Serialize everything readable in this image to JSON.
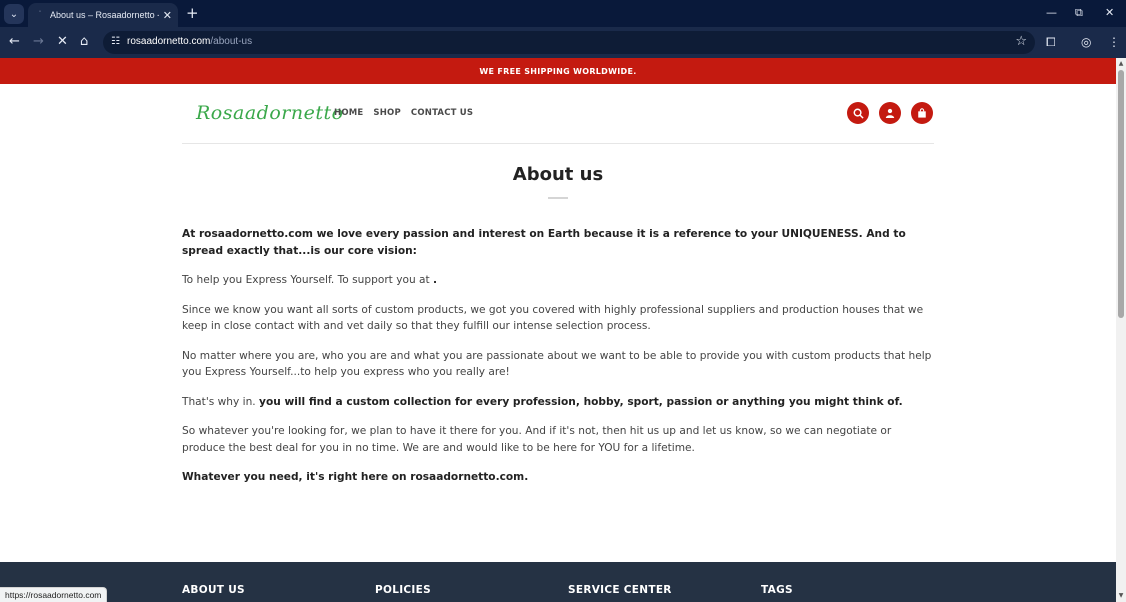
{
  "browser": {
    "tab_title": "About us – Rosaadornetto - Fre",
    "url_domain": "rosaadornetto.com",
    "url_path": "/about-us",
    "status_url": "https://rosaadornetto.com"
  },
  "site": {
    "announcement": "WE FREE SHIPPING WORLDWIDE.",
    "logo": "Rosaadornetto",
    "nav": [
      "HOME",
      "SHOP",
      "CONTACT US"
    ],
    "accent_color": "#c41a10",
    "logo_color": "#3aa84a"
  },
  "page": {
    "title": "About us",
    "p1": "At  rosaadornetto.com we love every passion and interest on Earth because it is a reference to your UNIQUENESS. And to spread exactly that...is our core vision:",
    "p2": "To help you Express Yourself. To support you at ",
    "p2_bold": ".",
    "p3": "Since we know you want all sorts of custom products, we got you covered with highly professional suppliers and production houses that we keep in close contact with and vet daily so that they fulfill our intense selection process.",
    "p4": "No matter where you are, who you are and what you are passionate about we want to be able to provide you with custom products that help you Express Yourself...to help you express who you really are!",
    "p5_lead": "That's why in. ",
    "p5_bold": "you will find a custom collection for every profession, hobby, sport, passion or anything you might think of.",
    "p6": "So whatever you're looking for, we plan to have it there for you. And if it's not, then hit us up and let us know, so we can negotiate or produce the best deal for you in no time. We are and would like to be here for YOU for a lifetime.",
    "p7": "Whatever you need, it's right here on rosaadornetto.com."
  },
  "footer": {
    "columns": [
      "ABOUT US",
      "POLICIES",
      "SERVICE CENTER",
      "TAGS"
    ]
  }
}
